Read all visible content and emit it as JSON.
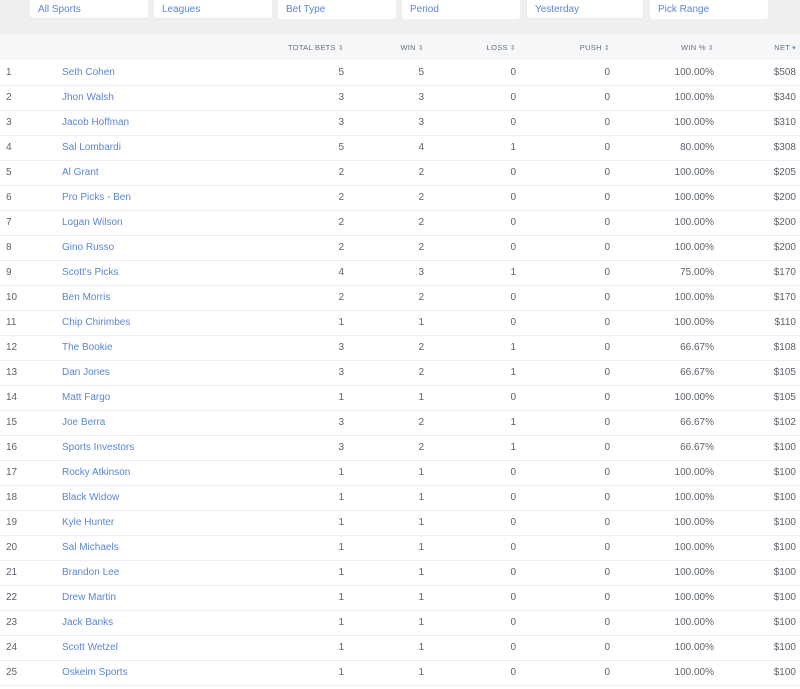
{
  "filters": [
    {
      "label": "All Sports"
    },
    {
      "label": "Leagues"
    },
    {
      "label": "Bet Type"
    },
    {
      "label": "Period"
    },
    {
      "label": "Yesterday"
    },
    {
      "label": "Pick Range"
    }
  ],
  "table": {
    "columns": [
      {
        "label": "",
        "sort_icon": ""
      },
      {
        "label": "",
        "sort_icon": ""
      },
      {
        "label": "TOTAL BETS",
        "sort_icon": "sort-both-icon"
      },
      {
        "label": "WIN",
        "sort_icon": "sort-both-icon"
      },
      {
        "label": "LOSS",
        "sort_icon": "sort-both-icon"
      },
      {
        "label": "PUSH",
        "sort_icon": "sort-both-icon"
      },
      {
        "label": "WIN %",
        "sort_icon": "sort-both-icon"
      },
      {
        "label": "NET",
        "sort_icon": "sort-desc-icon"
      }
    ],
    "rows": [
      {
        "rank": "1",
        "name": "Seth Cohen",
        "total": "5",
        "win": "5",
        "loss": "0",
        "push": "0",
        "pct": "100.00%",
        "net": "$508"
      },
      {
        "rank": "2",
        "name": "Jhon Walsh",
        "total": "3",
        "win": "3",
        "loss": "0",
        "push": "0",
        "pct": "100.00%",
        "net": "$340"
      },
      {
        "rank": "3",
        "name": "Jacob Hoffman",
        "total": "3",
        "win": "3",
        "loss": "0",
        "push": "0",
        "pct": "100.00%",
        "net": "$310"
      },
      {
        "rank": "4",
        "name": "Sal Lombardi",
        "total": "5",
        "win": "4",
        "loss": "1",
        "push": "0",
        "pct": "80.00%",
        "net": "$308"
      },
      {
        "rank": "5",
        "name": "Al Grant",
        "total": "2",
        "win": "2",
        "loss": "0",
        "push": "0",
        "pct": "100.00%",
        "net": "$205"
      },
      {
        "rank": "6",
        "name": "Pro Picks - Ben",
        "total": "2",
        "win": "2",
        "loss": "0",
        "push": "0",
        "pct": "100.00%",
        "net": "$200"
      },
      {
        "rank": "7",
        "name": "Logan Wilson",
        "total": "2",
        "win": "2",
        "loss": "0",
        "push": "0",
        "pct": "100.00%",
        "net": "$200"
      },
      {
        "rank": "8",
        "name": "Gino Russo",
        "total": "2",
        "win": "2",
        "loss": "0",
        "push": "0",
        "pct": "100.00%",
        "net": "$200"
      },
      {
        "rank": "9",
        "name": "Scott's Picks",
        "total": "4",
        "win": "3",
        "loss": "1",
        "push": "0",
        "pct": "75.00%",
        "net": "$170"
      },
      {
        "rank": "10",
        "name": "Ben Morris",
        "total": "2",
        "win": "2",
        "loss": "0",
        "push": "0",
        "pct": "100.00%",
        "net": "$170"
      },
      {
        "rank": "11",
        "name": "Chip Chirimbes",
        "total": "1",
        "win": "1",
        "loss": "0",
        "push": "0",
        "pct": "100.00%",
        "net": "$110"
      },
      {
        "rank": "12",
        "name": "The Bookie",
        "total": "3",
        "win": "2",
        "loss": "1",
        "push": "0",
        "pct": "66.67%",
        "net": "$108"
      },
      {
        "rank": "13",
        "name": "Dan Jones",
        "total": "3",
        "win": "2",
        "loss": "1",
        "push": "0",
        "pct": "66.67%",
        "net": "$105"
      },
      {
        "rank": "14",
        "name": "Matt Fargo",
        "total": "1",
        "win": "1",
        "loss": "0",
        "push": "0",
        "pct": "100.00%",
        "net": "$105"
      },
      {
        "rank": "15",
        "name": "Joe Berra",
        "total": "3",
        "win": "2",
        "loss": "1",
        "push": "0",
        "pct": "66.67%",
        "net": "$102"
      },
      {
        "rank": "16",
        "name": "Sports Investors",
        "total": "3",
        "win": "2",
        "loss": "1",
        "push": "0",
        "pct": "66.67%",
        "net": "$100"
      },
      {
        "rank": "17",
        "name": "Rocky Atkinson",
        "total": "1",
        "win": "1",
        "loss": "0",
        "push": "0",
        "pct": "100.00%",
        "net": "$100"
      },
      {
        "rank": "18",
        "name": "Black Widow",
        "total": "1",
        "win": "1",
        "loss": "0",
        "push": "0",
        "pct": "100.00%",
        "net": "$100"
      },
      {
        "rank": "19",
        "name": "Kyle Hunter",
        "total": "1",
        "win": "1",
        "loss": "0",
        "push": "0",
        "pct": "100.00%",
        "net": "$100"
      },
      {
        "rank": "20",
        "name": "Sal Michaels",
        "total": "1",
        "win": "1",
        "loss": "0",
        "push": "0",
        "pct": "100.00%",
        "net": "$100"
      },
      {
        "rank": "21",
        "name": "Brandon Lee",
        "total": "1",
        "win": "1",
        "loss": "0",
        "push": "0",
        "pct": "100.00%",
        "net": "$100"
      },
      {
        "rank": "22",
        "name": "Drew Martin",
        "total": "1",
        "win": "1",
        "loss": "0",
        "push": "0",
        "pct": "100.00%",
        "net": "$100"
      },
      {
        "rank": "23",
        "name": "Jack Banks",
        "total": "1",
        "win": "1",
        "loss": "0",
        "push": "0",
        "pct": "100.00%",
        "net": "$100"
      },
      {
        "rank": "24",
        "name": "Scott Wetzel",
        "total": "1",
        "win": "1",
        "loss": "0",
        "push": "0",
        "pct": "100.00%",
        "net": "$100"
      },
      {
        "rank": "25",
        "name": "Oskeim Sports",
        "total": "1",
        "win": "1",
        "loss": "0",
        "push": "0",
        "pct": "100.00%",
        "net": "$100"
      }
    ]
  },
  "colors": {
    "link": "#5b86d6",
    "filter_bar_bg": "#efefef",
    "header_bg": "#f6f7f9"
  }
}
